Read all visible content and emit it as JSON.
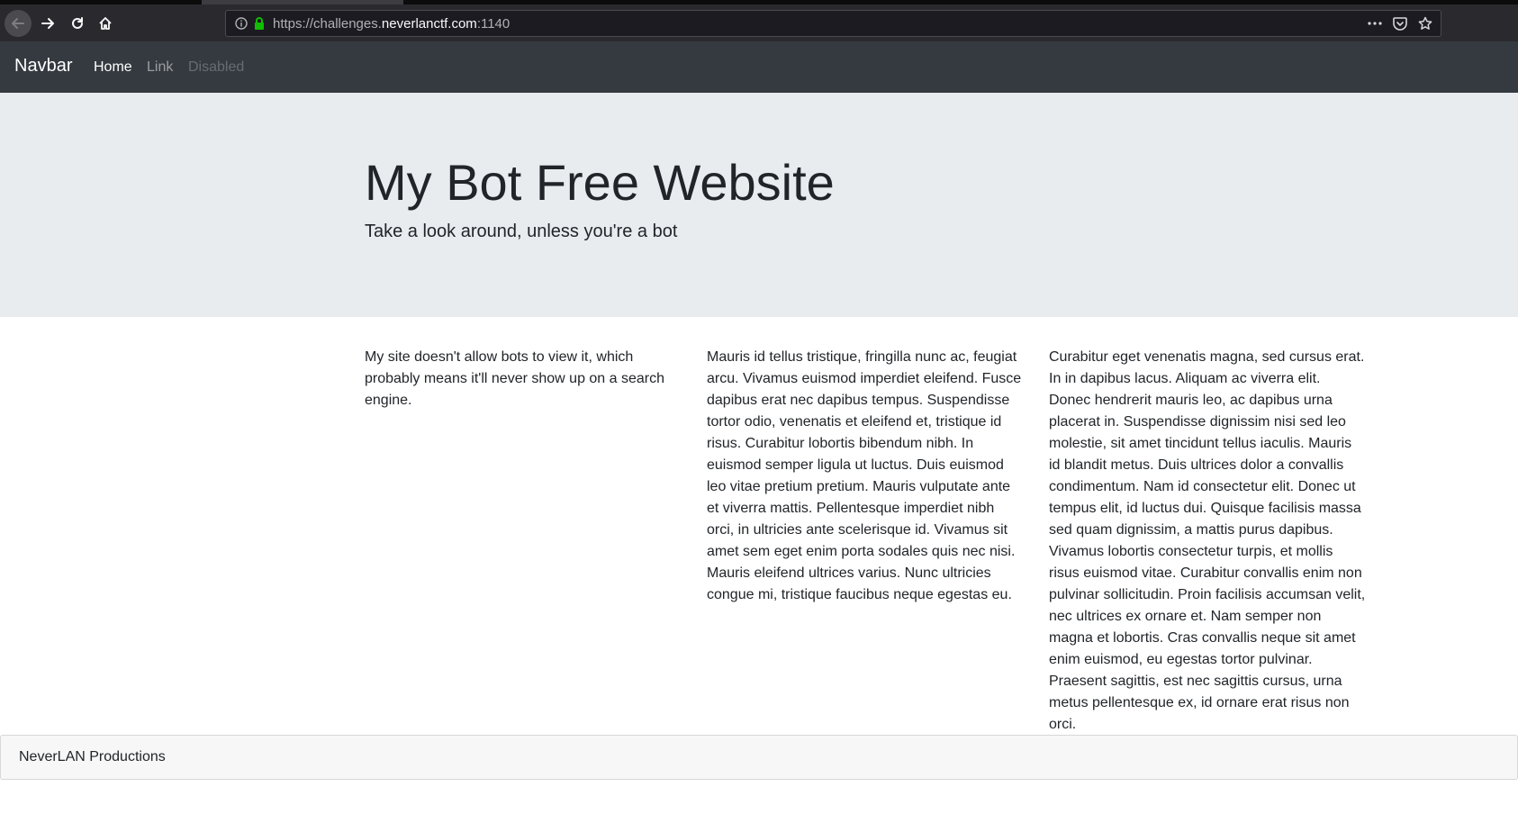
{
  "browser": {
    "url_prefix": "https://challenges.",
    "url_domain": "neverlanctf.com",
    "url_suffix": ":1140"
  },
  "navbar": {
    "brand": "Navbar",
    "links": [
      "Home",
      "Link",
      "Disabled"
    ]
  },
  "jumbotron": {
    "title": "My Bot Free Website",
    "lead": "Take a look around, unless you're a bot"
  },
  "columns": [
    "My site doesn't allow bots to view it, which probably means it'll never show up on a search engine.",
    "Mauris id tellus tristique, fringilla nunc ac, feugiat arcu. Vivamus euismod imperdiet eleifend. Fusce dapibus erat nec dapibus tempus. Suspendisse tortor odio, venenatis et eleifend et, tristique id risus. Curabitur lobortis bibendum nibh. In euismod semper ligula ut luctus. Duis euismod leo vitae pretium pretium. Mauris vulputate ante et viverra mattis. Pellentesque imperdiet nibh orci, in ultricies ante scelerisque id. Vivamus sit amet sem eget enim porta sodales quis nec nisi. Mauris eleifend ultrices varius. Nunc ultricies congue mi, tristique faucibus neque egestas eu.",
    "Curabitur eget venenatis magna, sed cursus erat. In in dapibus lacus. Aliquam ac viverra elit. Donec hendrerit mauris leo, ac dapibus urna placerat in. Suspendisse dignissim nisi sed leo molestie, sit amet tincidunt tellus iaculis. Mauris id blandit metus. Duis ultrices dolor a convallis condimentum. Nam id consectetur elit. Donec ut tempus elit, id luctus dui. Quisque facilisis massa sed quam dignissim, a mattis purus dapibus. Vivamus lobortis consectetur turpis, et mollis risus euismod vitae. Curabitur convallis enim non pulvinar sollicitudin. Proin facilisis accumsan velit, nec ultrices ex ornare et. Nam semper non magna et lobortis. Cras convallis neque sit amet enim euismod, eu egestas tortor pulvinar. Praesent sagittis, est nec sagittis cursus, urna metus pellentesque ex, id ornare erat risus non orci."
  ],
  "footer": {
    "text": "NeverLAN Productions"
  },
  "colors": {
    "navbar_bg": "#343a40",
    "jumbotron_bg": "#e9ecef",
    "footer_bg": "#f7f7f7",
    "chrome_bg": "#2a2a2e",
    "lock_green": "#12bc00"
  }
}
